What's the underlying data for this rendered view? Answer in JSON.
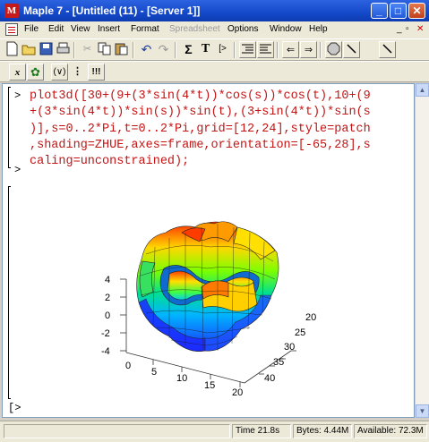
{
  "window": {
    "title": "Maple 7 - [Untitled (11) - [Server 1]]",
    "app_icon": "M"
  },
  "menubar": {
    "items": [
      "File",
      "Edit",
      "View",
      "Insert",
      "Format",
      "Spreadsheet",
      "Options",
      "Window",
      "Help"
    ],
    "disabled": [
      "Spreadsheet"
    ]
  },
  "toolbar2": {
    "x_label": "x",
    "paren_label": "(∨)",
    "colon_label": "⋮",
    "excl_label": "!!!"
  },
  "toolbar1": {
    "sigma_label": "Σ",
    "text_label": "T",
    "prompt_label": "[>"
  },
  "worksheet": {
    "input_prompt": ">",
    "input_lines": [
      "plot3d([30+(9+(3*sin(4*t))*cos(s))*cos(t),10+(9",
      "+(3*sin(4*t))*sin(s))*sin(t),(3+sin(4*t))*sin(s",
      ")],s=0..2*Pi,t=0..2*Pi,grid=[12,24],style=patch",
      ",shading=ZHUE,axes=frame,orientation=[-65,28],s",
      "caling=unconstrained);"
    ],
    "empty_prompt": ">",
    "last_prompt": "[>"
  },
  "plot": {
    "z_ticks": [
      "4",
      "2",
      "0",
      "-2",
      "-4"
    ],
    "x_ticks": [
      "0",
      "5",
      "10",
      "15",
      "20"
    ],
    "y_ticks": [
      "20",
      "25",
      "30",
      "35",
      "40"
    ]
  },
  "statusbar": {
    "time": "Time  21.8s",
    "bytes": "Bytes: 4.44M",
    "available": "Available: 72.3M"
  },
  "colors": {
    "input_text": "#c41414",
    "titlebar": "#1449c9"
  }
}
